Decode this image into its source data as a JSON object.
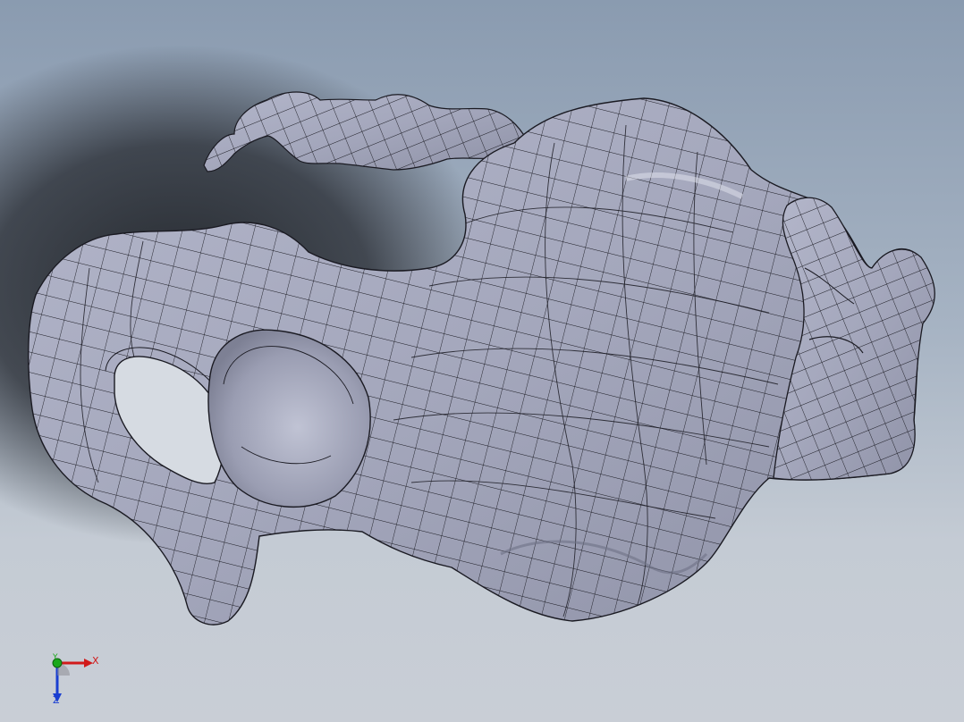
{
  "viewport": {
    "model": "pelvis-mesh",
    "background_top": "#8a9bb0",
    "background_bottom": "#c9ced6",
    "mesh_fill": "#a5a8bd",
    "mesh_line": "#1a1a22"
  },
  "triad": {
    "x_label": "X",
    "y_label": "Y",
    "z_label": "Z",
    "x_color": "#d11a1a",
    "y_color": "#1aa81a",
    "z_color": "#1a3fd1"
  }
}
